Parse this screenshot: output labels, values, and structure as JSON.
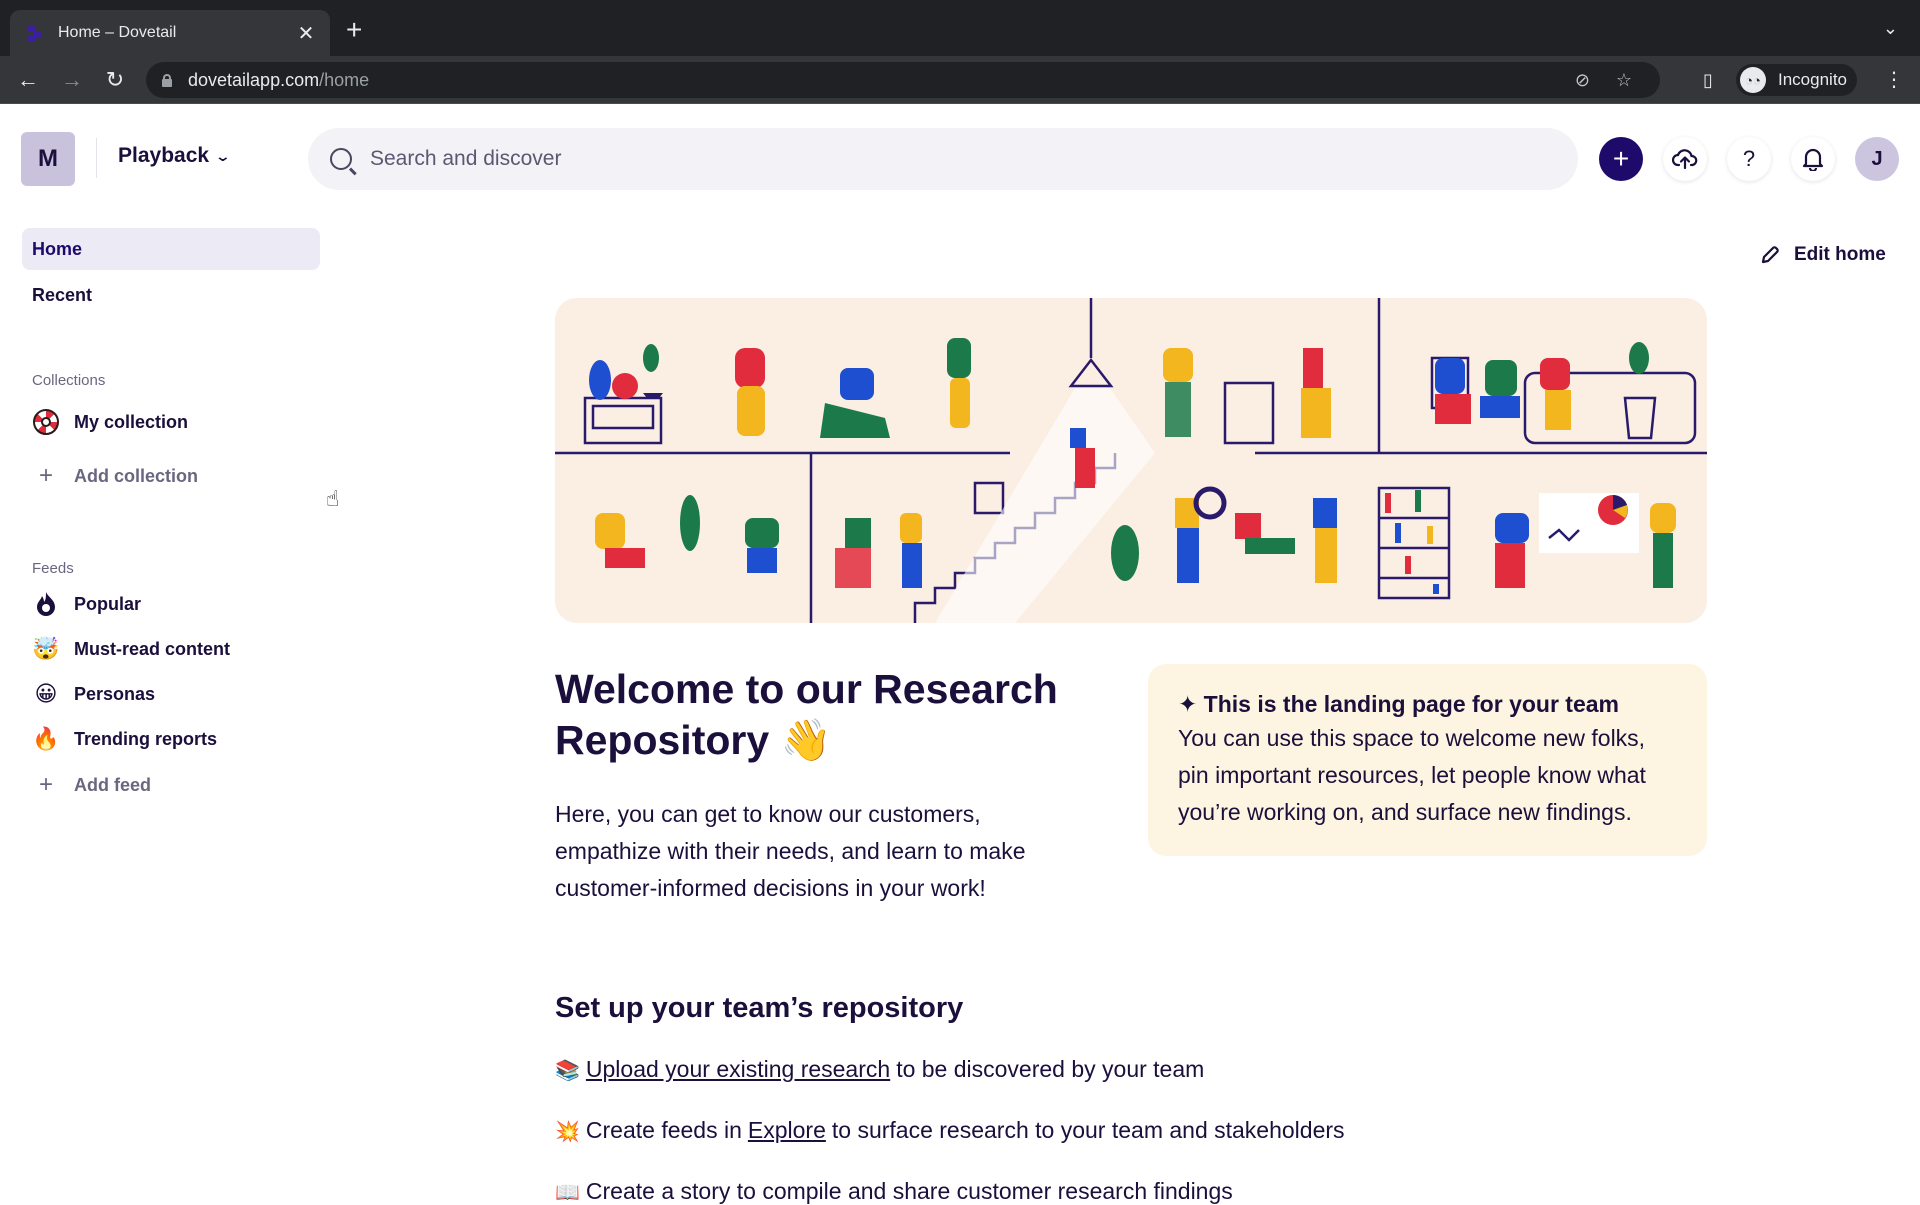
{
  "browser": {
    "tab_title": "Home – Dovetail",
    "url_host": "dovetailapp.com",
    "url_path": "/home",
    "profile_label": "Incognito"
  },
  "header": {
    "workspace_initial": "M",
    "workspace_name": "Playback",
    "search_placeholder": "Search and discover",
    "user_initial": "J",
    "icons": [
      "plus-icon",
      "cloud-upload-icon",
      "help-icon",
      "bell-icon"
    ]
  },
  "sidebar": {
    "nav": [
      {
        "label": "Home",
        "active": true
      },
      {
        "label": "Recent",
        "active": false
      }
    ],
    "collections_label": "Collections",
    "collections": [
      {
        "label": "My collection",
        "icon": "lifebuoy-icon"
      }
    ],
    "add_collection_label": "Add collection",
    "feeds_label": "Feeds",
    "feeds": [
      {
        "label": "Popular",
        "icon": "flame-icon",
        "glyph": "🔥"
      },
      {
        "label": "Must-read content",
        "icon": "exploding-head-icon",
        "glyph": "🤯"
      },
      {
        "label": "Personas",
        "icon": "grinning-face-icon",
        "glyph": "😀"
      },
      {
        "label": "Trending reports",
        "icon": "fire-icon",
        "glyph": "🔥"
      }
    ],
    "add_feed_label": "Add feed"
  },
  "main": {
    "edit_home_label": "Edit home",
    "welcome_title": "Welcome to our Research Repository 👋",
    "welcome_body": "Here, you can get to know our customers, empathize with their needs, and learn to make customer-informed decisions in your work!",
    "callout": {
      "title": "✦ This is the landing page for your team",
      "body": "You can use this space to welcome new folks, pin important resources, let people know what you’re working on, and surface new findings."
    },
    "setup_title": "Set up your team’s repository",
    "setup_items": [
      {
        "emoji": "📚",
        "link": "Upload your existing research",
        "pre": "",
        "post": "to be discovered by your team"
      },
      {
        "emoji": "💥",
        "pre": "Create feeds in",
        "link": "Explore",
        "post": "to surface research to your team and stakeholders"
      },
      {
        "emoji": "📖",
        "pre": "Create a story to compile and share customer research findings",
        "link": "",
        "post": ""
      }
    ],
    "colors": {
      "brand": "#1e0a6b",
      "hero_bg": "#fbeee3",
      "callout_bg": "#fdf4e1",
      "active_nav_bg": "#ecebf5"
    }
  }
}
